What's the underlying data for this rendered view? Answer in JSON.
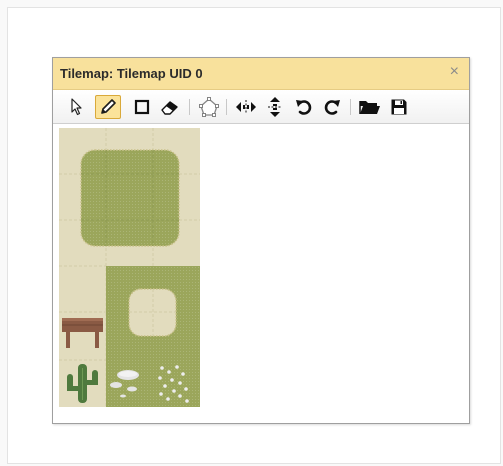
{
  "window": {
    "title": "Tilemap: Tilemap UID 0",
    "close_glyph": "×"
  },
  "toolbar": {
    "tools": [
      {
        "name": "select-icon",
        "active": false
      },
      {
        "name": "pencil-icon",
        "active": true
      },
      {
        "name": "rectangle-icon",
        "active": false
      },
      {
        "name": "eraser-icon",
        "active": false
      },
      {
        "name": "shape-tool-icon",
        "active": false
      },
      {
        "name": "flip-horizontal-icon",
        "active": false
      },
      {
        "name": "flip-vertical-icon",
        "active": false
      },
      {
        "name": "rotate-ccw-icon",
        "active": false
      },
      {
        "name": "rotate-cw-icon",
        "active": false
      },
      {
        "name": "open-folder-icon",
        "active": false
      },
      {
        "name": "save-icon",
        "active": false
      }
    ]
  },
  "colors": {
    "title_bar": "#f8e19c",
    "active_tool": "#fbe39a",
    "sand": "#e2dcbe",
    "grass": "#9ba65b",
    "wood": "#8a5a44",
    "cactus": "#4f7a3e",
    "rock": "#e4e4e4"
  }
}
